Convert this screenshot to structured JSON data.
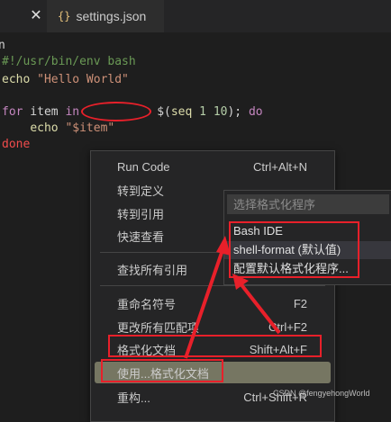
{
  "tab": {
    "close_glyph": "✕",
    "icon_glyph": "{}",
    "title": "settings.json"
  },
  "editor": {
    "lines": {
      "l0": "n",
      "l1": "#!/usr/bin/env bash",
      "l2_cmd": "echo",
      "l2_str": "\"Hello World\"",
      "l3_for": "for",
      "l3_var": " item ",
      "l3_in": "in",
      "l3_gap": "           ",
      "l3_dollar": "$(",
      "l3_seq": "seq",
      "l3_num1": " 1 ",
      "l3_num2": "10",
      "l3_close": ");",
      "l3_do": " do",
      "l4_indent": "    ",
      "l4_cmd": "echo",
      "l4_str": " \"$item\"",
      "l5": "done"
    }
  },
  "context_menu": {
    "items": [
      {
        "label": "Run Code",
        "shortcut": "Ctrl+Alt+N"
      },
      {
        "label": "转到定义",
        "shortcut": ""
      },
      {
        "label": "转到引用",
        "shortcut": ""
      },
      {
        "label": "快速查看",
        "shortcut": ""
      },
      {
        "label": "查找所有引用",
        "shortcut": ""
      },
      {
        "label": "重命名符号",
        "shortcut": "F2"
      },
      {
        "label": "更改所有匹配项",
        "shortcut": "Ctrl+F2"
      },
      {
        "label": "格式化文档",
        "shortcut": "Shift+Alt+F"
      },
      {
        "label": "使用...格式化文档",
        "shortcut": ""
      },
      {
        "label": "重构...",
        "shortcut": "Ctrl+Shift+R"
      }
    ]
  },
  "formatter_picker": {
    "placeholder": "选择格式化程序",
    "options": [
      {
        "label": "Bash IDE"
      },
      {
        "label": "shell-format (默认值)"
      },
      {
        "label": "配置默认格式化程序..."
      }
    ]
  },
  "watermark": "CSDN @fengyehongWorld",
  "colors": {
    "annotation_red": "#e8202a",
    "highlight": "#767662"
  }
}
